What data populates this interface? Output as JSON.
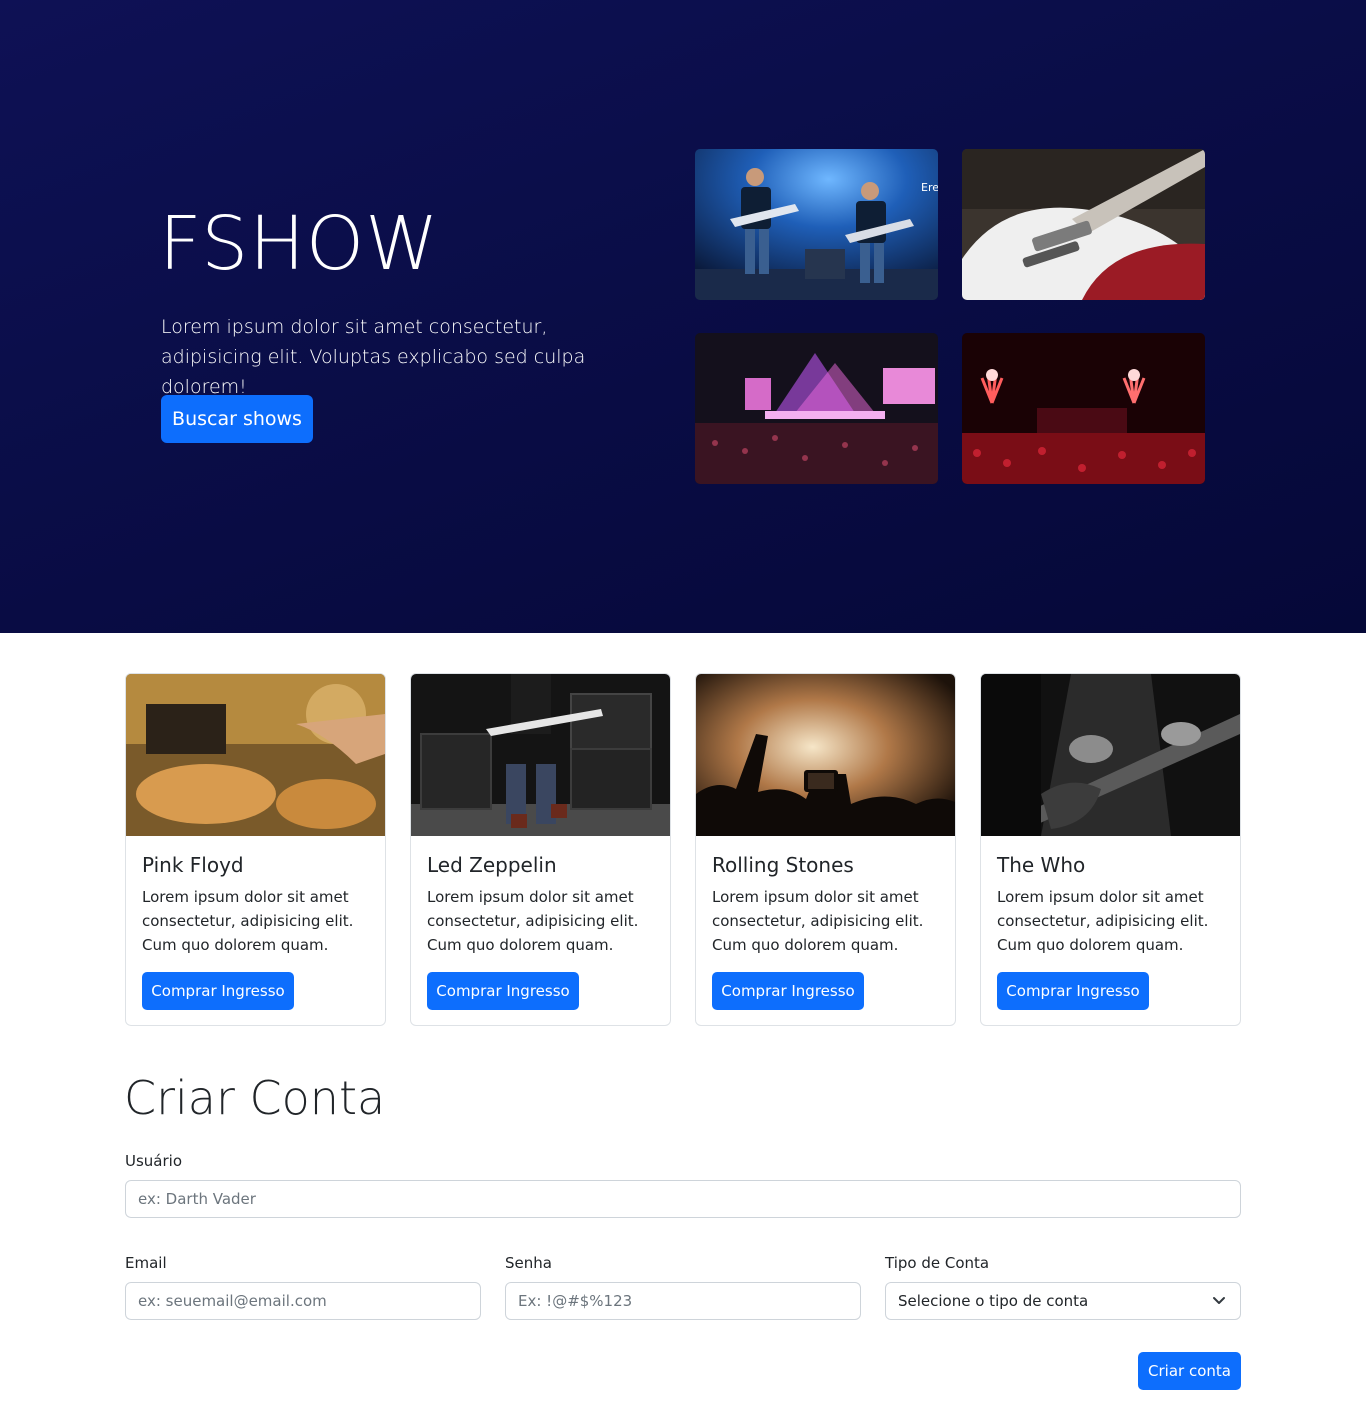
{
  "hero": {
    "title": "FSHOW",
    "text": "Lorem ipsum dolor sit amet consectetur, adipisicing elit. Voluptas explicabo sed culpa dolorem!",
    "button_label": "Buscar shows",
    "photos": [
      "band-on-stage-photo",
      "electric-guitar-photo",
      "concert-crowd-photo",
      "fireworks-stage-photo"
    ]
  },
  "cards": [
    {
      "title": "Pink Floyd",
      "text": "Lorem ipsum dolor sit amet consectetur, adipisicing elit. Cum quo dolorem quam.",
      "button_label": "Comprar Ingresso"
    },
    {
      "title": "Led Zeppelin",
      "text": "Lorem ipsum dolor sit amet consectetur, adipisicing elit. Cum quo dolorem quam.",
      "button_label": "Comprar Ingresso"
    },
    {
      "title": "Rolling Stones",
      "text": "Lorem ipsum dolor sit amet consectetur, adipisicing elit. Cum quo dolorem quam.",
      "button_label": "Comprar Ingresso"
    },
    {
      "title": "The Who",
      "text": "Lorem ipsum dolor sit amet consectetur, adipisicing elit. Cum quo dolorem quam.",
      "button_label": "Comprar Ingresso"
    }
  ],
  "form": {
    "title": "Criar Conta",
    "user_label": "Usuário",
    "user_placeholder": "ex: Darth Vader",
    "email_label": "Email",
    "email_placeholder": "ex: seuemail@email.com",
    "password_label": "Senha",
    "password_placeholder": "Ex: !@#$%123",
    "account_type_label": "Tipo de Conta",
    "account_type_selected": "Selecione o tipo de conta",
    "submit_label": "Criar conta"
  },
  "colors": {
    "hero_bg": "#0a0d47",
    "primary": "#0d6efd",
    "border": "#dee2e6"
  }
}
